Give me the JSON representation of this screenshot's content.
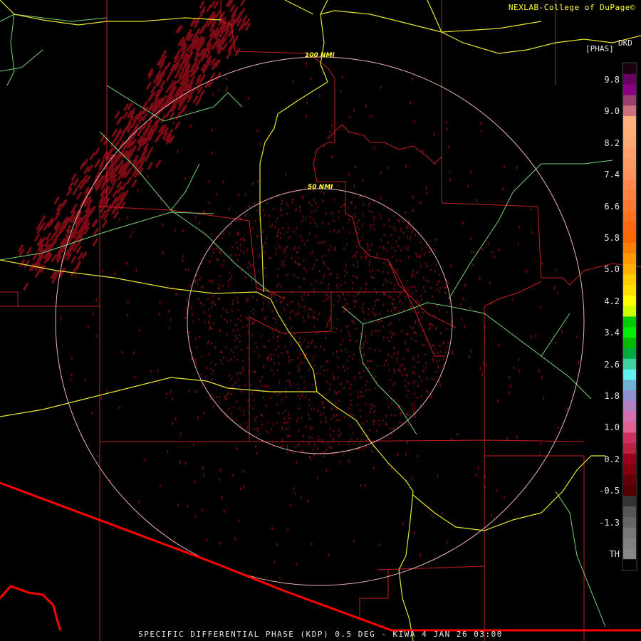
{
  "credit": "NEXLAB-College of DuPage©",
  "caption": "SPECIFIC DIFFERENTIAL PHASE (KDP) 0.5 DEG - KIWA 4 JAN 26 03:00",
  "legend": {
    "unit_line1": "DKD",
    "unit_line2": "[PHAS]",
    "ticks": [
      "9.8",
      "9.0",
      "8.2",
      "7.4",
      "6.6",
      "5.8",
      "5.0",
      "4.2",
      "3.4",
      "2.6",
      "1.8",
      "1.0",
      "0.2",
      "-0.5",
      "-1.3",
      "TH"
    ],
    "colors": [
      "#1a0010",
      "#660060",
      "#8a0080",
      "#993f6b",
      "#cc7080",
      "#ffb080",
      "#ffb07a",
      "#ffa878",
      "#ffa070",
      "#ff9868",
      "#ff9060",
      "#ff8850",
      "#ff8040",
      "#ff7830",
      "#ff7020",
      "#ff6810",
      "#ff6600",
      "#ff8000",
      "#ff9900",
      "#ffb000",
      "#ffcc00",
      "#ffe000",
      "#ffff00",
      "#d0ff00",
      "#00cc00",
      "#00ee00",
      "#00bb00",
      "#00aa40",
      "#40d0a0",
      "#60f0f0",
      "#70b0d0",
      "#9090d0",
      "#b080c0",
      "#d070b0",
      "#e06090",
      "#cc3060",
      "#bb2040",
      "#990020",
      "#800010",
      "#600008",
      "#500000",
      "#333333",
      "#555555",
      "#666666",
      "#777777",
      "#808080",
      "#888888",
      "#000000"
    ]
  },
  "rings": [
    {
      "label": "100 NMI"
    },
    {
      "label": "50 NMI"
    }
  ],
  "colors": {
    "county": "#c81e1e",
    "highway_yellow": "#e6e632",
    "highway_green": "#78d278",
    "range_ring": "#f0b4b4",
    "border": "#ff0000",
    "echo": "#7a0a14"
  }
}
